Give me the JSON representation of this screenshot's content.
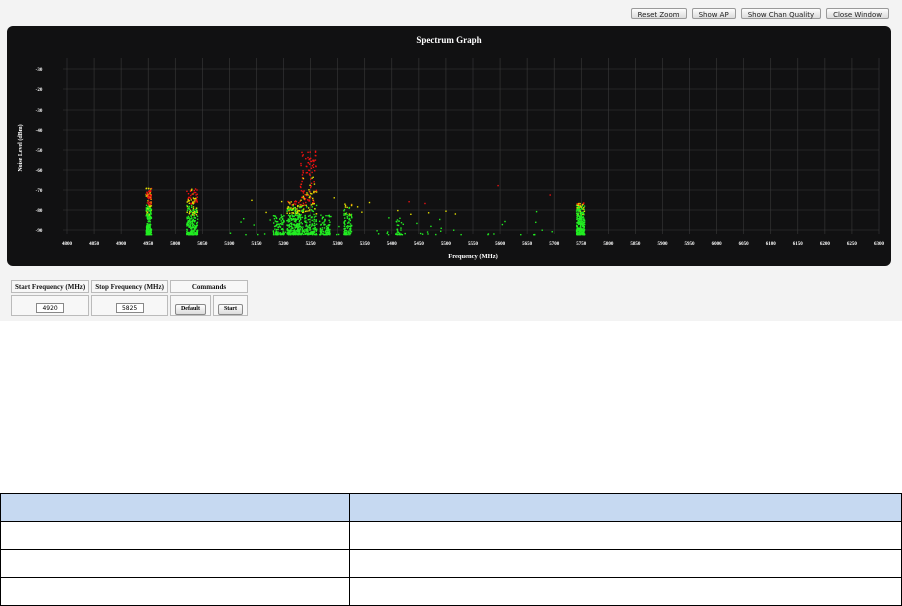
{
  "toolbar": {
    "buttons": [
      "Reset Zoom",
      "Show AP",
      "Show Chan Quality",
      "Close Window"
    ]
  },
  "chart_data": {
    "type": "scatter",
    "title": "Spectrum Graph",
    "xlabel": "Frequency (MHz)",
    "ylabel": "Noise Level (dBm)",
    "xlim": [
      4800,
      6300
    ],
    "ylim": [
      -96,
      -26
    ],
    "x_ticks": [
      4800,
      4850,
      4900,
      4950,
      5000,
      5050,
      5100,
      5150,
      5200,
      5250,
      5300,
      5350,
      5400,
      5450,
      5500,
      5550,
      5600,
      5650,
      5700,
      5750,
      5800,
      5850,
      5900,
      5950,
      6000,
      6050,
      6100,
      6150,
      6200,
      6250,
      6300
    ],
    "x_tick_labels": [
      "4800",
      "4850",
      "4900",
      "4950",
      "5000",
      "5050",
      "5100",
      "5150",
      "5200",
      "5250",
      "5300",
      "5350",
      "5400",
      "5450",
      "5500",
      "5550",
      "5600",
      "5650",
      "5700",
      "5750",
      "5800",
      "5850",
      "5900",
      "5950",
      "6000",
      "6050",
      "6100",
      "6150",
      "6200",
      "6250",
      "6300"
    ],
    "y_ticks": [
      -30,
      -40,
      -50,
      -60,
      -70,
      -80,
      -90
    ],
    "y_tick_labels": [
      "-30",
      "-20",
      "-30",
      "-40",
      "-50",
      "-60",
      "-70",
      "-80",
      "-90"
    ],
    "grid": true,
    "colors": {
      "low": "#22ee22",
      "mid": "#e6e000",
      "high": "#ee1111",
      "background": "#111112",
      "grid": "#3a3a3a"
    },
    "clusters": [
      {
        "x_range": [
          4945,
          4955
        ],
        "y_top": -77,
        "density": "high"
      },
      {
        "x_range": [
          5020,
          5040
        ],
        "y_top": -77,
        "density": "high"
      },
      {
        "x_range": [
          5180,
          5200
        ],
        "y_top": -88,
        "density": "medium"
      },
      {
        "x_range": [
          5205,
          5230
        ],
        "y_top": -82,
        "density": "high"
      },
      {
        "x_range": [
          5230,
          5260
        ],
        "y_top": -62,
        "density": "high"
      },
      {
        "x_range": [
          5265,
          5285
        ],
        "y_top": -88,
        "density": "medium"
      },
      {
        "x_range": [
          5310,
          5325
        ],
        "y_top": -83,
        "density": "medium"
      },
      {
        "x_range": [
          5405,
          5420
        ],
        "y_top": -89,
        "density": "low"
      },
      {
        "x_range": [
          5740,
          5755
        ],
        "y_top": -83,
        "density": "high"
      }
    ]
  },
  "controls": {
    "headers": [
      "Start Frequency (MHz)",
      "Stop Frequency (MHz)",
      "Commands"
    ],
    "start_frequency": "4920",
    "stop_frequency": "5825",
    "default_label": "Default",
    "start_label": "Start"
  },
  "doc_table": {
    "rows": [
      [
        "",
        ""
      ],
      [
        "",
        ""
      ],
      [
        "",
        ""
      ],
      [
        "",
        ""
      ]
    ]
  }
}
